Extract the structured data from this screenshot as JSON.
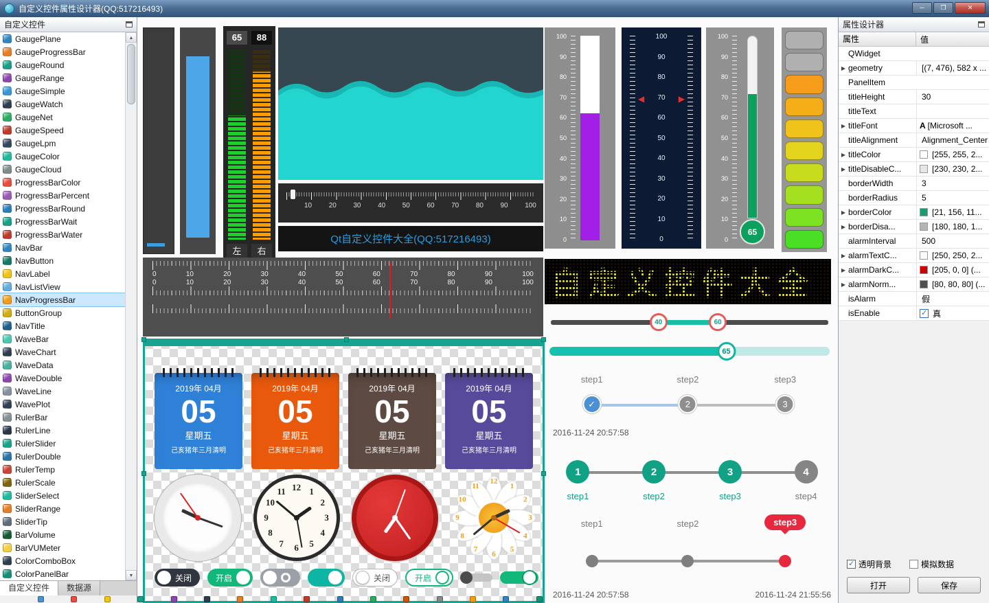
{
  "window": {
    "title": "自定义控件属性设计器(QQ:517216493)",
    "buttons": {
      "minimize": "─",
      "maximize": "❐",
      "close": "✕"
    }
  },
  "left_panel": {
    "header": "自定义控件",
    "tabs": [
      {
        "label": "自定义控件",
        "active": true
      },
      {
        "label": "数据源",
        "active": false
      }
    ],
    "items": [
      {
        "label": "GaugePlane",
        "color": "#2e86c1"
      },
      {
        "label": "GaugeProgressBar",
        "color": "#e67e22"
      },
      {
        "label": "GaugeRound",
        "color": "#16a085"
      },
      {
        "label": "GaugeRange",
        "color": "#8e44ad"
      },
      {
        "label": "GaugeSimple",
        "color": "#3498db"
      },
      {
        "label": "GaugeWatch",
        "color": "#2c3e50"
      },
      {
        "label": "GaugeNet",
        "color": "#27ae60"
      },
      {
        "label": "GaugeSpeed",
        "color": "#c0392b"
      },
      {
        "label": "GaugeLpm",
        "color": "#34495e"
      },
      {
        "label": "GaugeColor",
        "color": "#1abc9c"
      },
      {
        "label": "GaugeCloud",
        "color": "#7f8c8d"
      },
      {
        "label": "ProgressBarColor",
        "color": "#e74c3c"
      },
      {
        "label": "ProgressBarPercent",
        "color": "#9b59b6"
      },
      {
        "label": "ProgressBarRound",
        "color": "#2980b9"
      },
      {
        "label": "ProgressBarWait",
        "color": "#16a085"
      },
      {
        "label": "ProgressBarWater",
        "color": "#c0392b"
      },
      {
        "label": "NavBar",
        "color": "#2e86c1"
      },
      {
        "label": "NavButton",
        "color": "#117a65"
      },
      {
        "label": "NavLabel",
        "color": "#f1c40f"
      },
      {
        "label": "NavListView",
        "color": "#5dade2"
      },
      {
        "label": "NavProgressBar",
        "color": "#f39c12",
        "selected": true
      },
      {
        "label": "ButtonGroup",
        "color": "#d4ac0d"
      },
      {
        "label": "NavTitle",
        "color": "#1f618d"
      },
      {
        "label": "WaveBar",
        "color": "#48c9b0"
      },
      {
        "label": "WaveChart",
        "color": "#2c3e50"
      },
      {
        "label": "WaveData",
        "color": "#45b39d"
      },
      {
        "label": "WaveDouble",
        "color": "#8e44ad"
      },
      {
        "label": "WaveLine",
        "color": "#85929e"
      },
      {
        "label": "WavePlot",
        "color": "#2e4053"
      },
      {
        "label": "RulerBar",
        "color": "#839192"
      },
      {
        "label": "RulerLine",
        "color": "#283747"
      },
      {
        "label": "RulerSlider",
        "color": "#17a589"
      },
      {
        "label": "RulerDouble",
        "color": "#2874a6"
      },
      {
        "label": "RulerTemp",
        "color": "#cb4335"
      },
      {
        "label": "RulerScale",
        "color": "#7d6608"
      },
      {
        "label": "SliderSelect",
        "color": "#1abc9c"
      },
      {
        "label": "SliderRange",
        "color": "#e67e22"
      },
      {
        "label": "SliderTip",
        "color": "#5d6d7e"
      },
      {
        "label": "BarVolume",
        "color": "#145a32"
      },
      {
        "label": "BarVUMeter",
        "color": "#f4d03f"
      },
      {
        "label": "ColorComboBox",
        "color": "#2c3e50"
      },
      {
        "label": "ColorPanelBar",
        "color": "#148f77"
      }
    ]
  },
  "canvas": {
    "led_meter": {
      "left_value": "65",
      "right_value": "88",
      "left_label": "左",
      "right_label": "右"
    },
    "ruler_progress": {
      "ticks": [
        "10",
        "20",
        "30",
        "40",
        "50",
        "60",
        "70",
        "80",
        "90",
        "100"
      ]
    },
    "banner": {
      "text": "Qt自定义控件大全(QQ:517216493)"
    },
    "purple_scale": {
      "ticks": [
        "100",
        "90",
        "80",
        "70",
        "60",
        "50",
        "40",
        "30",
        "20",
        "10",
        "0"
      ]
    },
    "navy_scale": {
      "ticks": [
        "100",
        "90",
        "80",
        "70",
        "60",
        "50",
        "40",
        "30",
        "20",
        "10",
        "0"
      ]
    },
    "thermometer": {
      "value": "65",
      "ticks": [
        "100",
        "90",
        "80",
        "70",
        "60",
        "50",
        "40",
        "30",
        "20",
        "10",
        "0"
      ]
    },
    "led_column": {
      "colors": [
        "#b0b0b0",
        "#b0b0b0",
        "#f59c1a",
        "#f5ae17",
        "#efc319",
        "#e2d31c",
        "#c8dc1e",
        "#a5e020",
        "#7ce222",
        "#4ade24"
      ]
    },
    "big_ruler": {
      "ticks": [
        "0",
        "10",
        "20",
        "30",
        "40",
        "50",
        "60",
        "70",
        "80",
        "90",
        "100"
      ]
    },
    "calendars": [
      {
        "month": "2019年 04月",
        "day": "05",
        "week": "星期五",
        "lunar": "己亥猪年三月清明",
        "color": "#2f81d8"
      },
      {
        "month": "2019年 04月",
        "day": "05",
        "week": "星期五",
        "lunar": "己亥猪年三月清明",
        "color": "#e8590c"
      },
      {
        "month": "2019年 04月",
        "day": "05",
        "week": "星期五",
        "lunar": "己亥猪年三月清明",
        "color": "#5d4a42"
      },
      {
        "month": "2019年 04月",
        "day": "05",
        "week": "星期五",
        "lunar": "己亥猪年三月清明",
        "color": "#584a9b"
      }
    ],
    "clock_numbers": [
      "12",
      "1",
      "2",
      "3",
      "4",
      "5",
      "6",
      "7",
      "8",
      "9",
      "10",
      "11"
    ],
    "toggles": [
      {
        "label": "关闭",
        "style": "dark",
        "knob": "left"
      },
      {
        "label": "开启",
        "style": "green",
        "knob": "right"
      },
      {
        "label": "",
        "style": "gray-ring",
        "knob": "left"
      },
      {
        "label": "",
        "style": "teal",
        "knob": "right"
      },
      {
        "label": "关闭",
        "style": "light",
        "knob": "left"
      },
      {
        "label": "开启",
        "style": "light-green",
        "knob": "right"
      },
      {
        "label": "",
        "style": "mini-gray",
        "knob": "left"
      },
      {
        "label": "",
        "style": "mini-green",
        "knob": "right"
      }
    ],
    "led_text": {
      "text": "自定义控件大全"
    },
    "range_slider": {
      "low": "40",
      "high": "60"
    },
    "value_slider": {
      "value": "65"
    },
    "steps_a": {
      "labels": [
        "step1",
        "step2",
        "step3"
      ],
      "nodes": [
        {
          "text": "✓",
          "state": "done"
        },
        {
          "text": "2"
        },
        {
          "text": "3"
        }
      ],
      "timestamp": "2016-11-24 20:57:58"
    },
    "steps_b": {
      "nodes": [
        {
          "text": "1",
          "state": "active"
        },
        {
          "text": "2",
          "state": "active"
        },
        {
          "text": "3",
          "state": "active"
        },
        {
          "text": "4"
        }
      ],
      "labels": [
        {
          "text": "step1",
          "state": "active"
        },
        {
          "text": "step2",
          "state": "active"
        },
        {
          "text": "step3",
          "state": "active"
        },
        {
          "text": "step4"
        }
      ]
    },
    "steps_c": {
      "labels": [
        "step1",
        "step2"
      ],
      "balloon": "step3",
      "nodes": [
        {
          "state": "idle"
        },
        {
          "state": "idle"
        },
        {
          "state": "alarm"
        }
      ],
      "timestamp_left": "2016-11-24 20:57:58",
      "timestamp_right": "2016-11-24 21:55:56"
    }
  },
  "right_panel": {
    "header": "属性设计器",
    "columns": [
      "属性",
      "值"
    ],
    "rows": [
      {
        "name": "QWidget",
        "value": "",
        "group": true
      },
      {
        "name": "geometry",
        "value": "[(7, 476), 582 x ...",
        "expand": true
      },
      {
        "name": "PanelItem",
        "value": "",
        "group": true
      },
      {
        "name": "titleHeight",
        "value": "30"
      },
      {
        "name": "titleText",
        "value": ""
      },
      {
        "name": "titleFont",
        "value": "[Microsoft ...",
        "expand": true,
        "icon": "A"
      },
      {
        "name": "titleAlignment",
        "value": "Alignment_Center"
      },
      {
        "name": "titleColor",
        "value": "[255, 255, 2...",
        "expand": true,
        "swatch": "#ffffff"
      },
      {
        "name": "titleDisableC...",
        "value": "[230, 230, 2...",
        "expand": true,
        "swatch": "#e6e6e6"
      },
      {
        "name": "borderWidth",
        "value": "3"
      },
      {
        "name": "borderRadius",
        "value": "5"
      },
      {
        "name": "borderColor",
        "value": "[21, 156, 11...",
        "expand": true,
        "swatch": "#159c71"
      },
      {
        "name": "borderDisa...",
        "value": "[180, 180, 1...",
        "expand": true,
        "swatch": "#b4b4b4"
      },
      {
        "name": "alarmInterval",
        "value": "500"
      },
      {
        "name": "alarmTextC...",
        "value": "[250, 250, 2...",
        "expand": true,
        "swatch": "#fafafa"
      },
      {
        "name": "alarmDarkC...",
        "value": "[205, 0, 0] (...",
        "expand": true,
        "swatch": "#cd0000"
      },
      {
        "name": "alarmNorm...",
        "value": "[80, 80, 80] (...",
        "expand": true,
        "swatch": "#505050"
      },
      {
        "name": "isAlarm",
        "value": "假"
      },
      {
        "name": "isEnable",
        "value": "真",
        "checkbox": true
      }
    ],
    "footer": {
      "transparent_bg": "透明背景",
      "mock_data": "模拟数据",
      "open_button": "打开",
      "save_button": "保存"
    }
  },
  "bottom_strip": {
    "colors": [
      "#4a90d2",
      "#e74c3c",
      "#f1c40f",
      "#16a085",
      "#8e44ad",
      "#2c3e50",
      "#e67e22",
      "#1abc9c",
      "#c0392b",
      "#2980b9",
      "#27ae60",
      "#d35400",
      "#7f8c8d",
      "#f39c12",
      "#2e86c1",
      "#148f77"
    ]
  }
}
